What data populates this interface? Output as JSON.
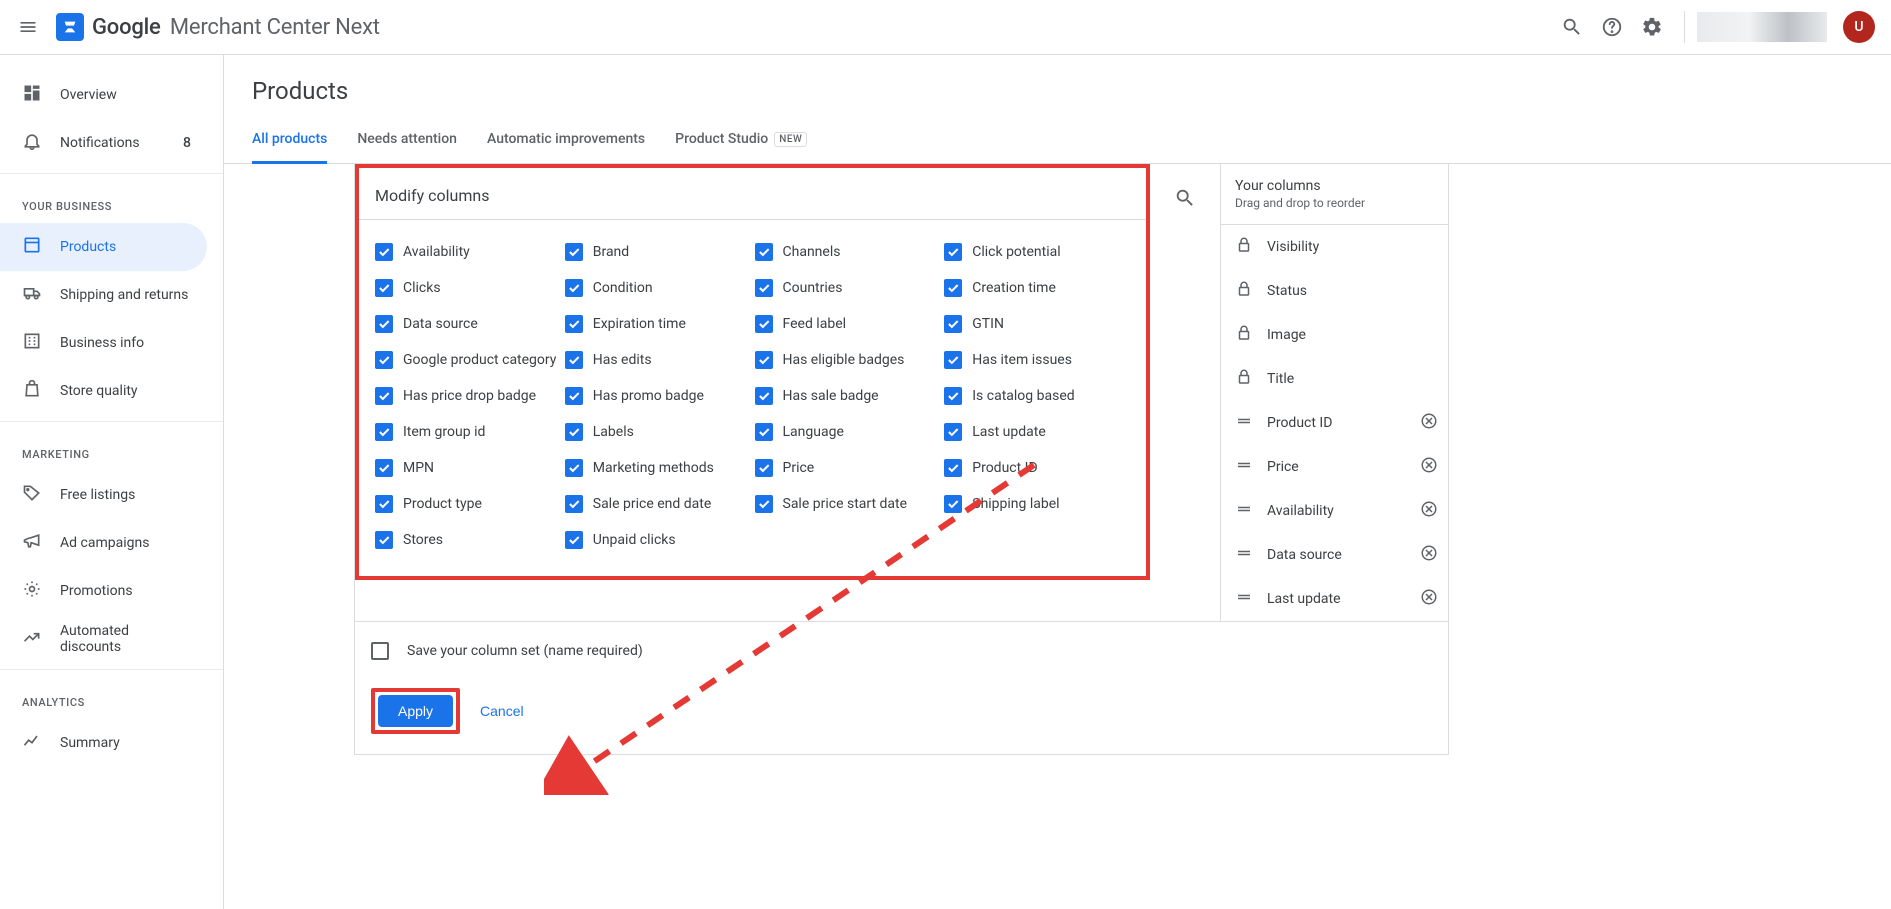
{
  "brand": {
    "strong": "Google",
    "rest": "Merchant Center Next"
  },
  "avatar_initial": "U",
  "sidebar": {
    "overview": "Overview",
    "notifications": "Notifications",
    "notifications_count": "8",
    "section_business": "YOUR BUSINESS",
    "products": "Products",
    "shipping": "Shipping and returns",
    "business_info": "Business info",
    "store_quality": "Store quality",
    "section_marketing": "MARKETING",
    "free_listings": "Free listings",
    "ad_campaigns": "Ad campaigns",
    "promotions": "Promotions",
    "automated_discounts": "Automated discounts",
    "section_analytics": "ANALYTICS",
    "summary": "Summary"
  },
  "page_title": "Products",
  "tabs": {
    "all": "All products",
    "needs": "Needs attention",
    "auto": "Automatic improvements",
    "studio": "Product Studio",
    "new_badge": "NEW"
  },
  "modify": {
    "title": "Modify columns",
    "items": [
      "Availability",
      "Brand",
      "Channels",
      "Click potential",
      "Clicks",
      "Condition",
      "Countries",
      "Creation time",
      "Data source",
      "Expiration time",
      "Feed label",
      "GTIN",
      "Google product category",
      "Has edits",
      "Has eligible badges",
      "Has item issues",
      "Has price drop badge",
      "Has promo badge",
      "Has sale badge",
      "Is catalog based",
      "Item group id",
      "Labels",
      "Language",
      "Last update",
      "MPN",
      "Marketing methods",
      "Price",
      "Product ID",
      "Product type",
      "Sale price end date",
      "Sale price start date",
      "Shipping label",
      "Stores",
      "Unpaid clicks"
    ]
  },
  "your_columns": {
    "title": "Your columns",
    "subtitle": "Drag and drop to reorder",
    "locked": [
      "Visibility",
      "Status",
      "Image",
      "Title"
    ],
    "draggable": [
      "Product ID",
      "Price",
      "Availability",
      "Data source",
      "Last update"
    ]
  },
  "footer": {
    "save_text": "Save your column set (name required)",
    "apply": "Apply",
    "cancel": "Cancel"
  }
}
